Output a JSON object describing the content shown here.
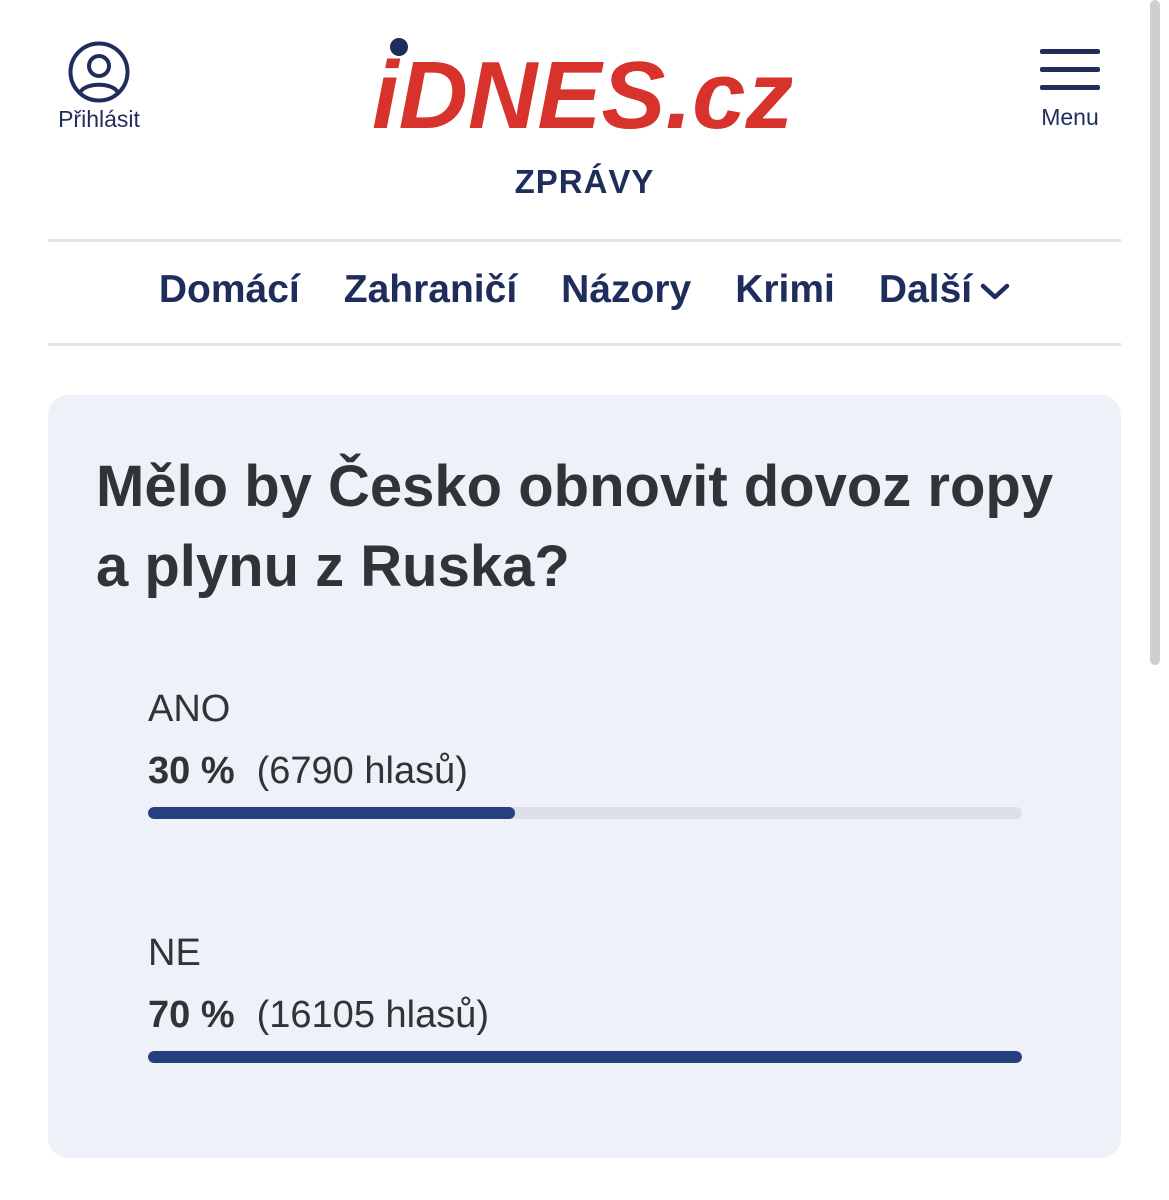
{
  "header": {
    "login_label": "Přihlásit",
    "menu_label": "Menu",
    "brand_main": "iDNES",
    "brand_tld": ".cz",
    "section": "ZPRÁVY"
  },
  "nav": {
    "items": [
      {
        "label": "Domácí"
      },
      {
        "label": "Zahraničí"
      },
      {
        "label": "Názory"
      },
      {
        "label": "Krimi"
      },
      {
        "label": "Další"
      }
    ]
  },
  "poll": {
    "question": "Mělo by Česko obnovit dovoz ropy a plynu z Ruska?",
    "options": [
      {
        "label": "ANO",
        "percent": "30 %",
        "votes": "(6790 hlasů)",
        "share": 0.42
      },
      {
        "label": "NE",
        "percent": "70 %",
        "votes": "(16105 hlasů)",
        "share": 1.0
      }
    ]
  },
  "colors": {
    "brand_red": "#d7332c",
    "brand_navy": "#1f2d5c",
    "bar_fill": "#263f7e",
    "bar_track": "#dadfe9",
    "card_bg": "#eef2f8"
  },
  "icons": {
    "login": "user-circle-icon",
    "menu": "hamburger-icon",
    "more": "chevron-down-icon"
  }
}
